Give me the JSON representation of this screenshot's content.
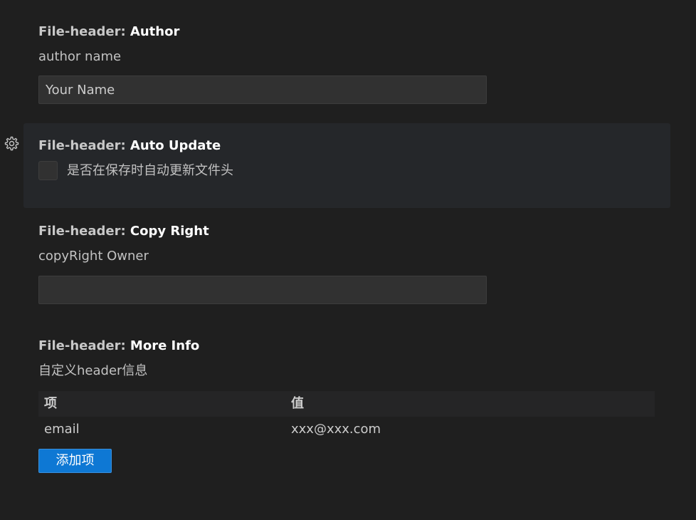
{
  "settings": {
    "author": {
      "category": "File-header: ",
      "name": "Author",
      "description": "author name",
      "value": "Your Name"
    },
    "auto_update": {
      "category": "File-header: ",
      "name": "Auto Update",
      "checkbox_label": "是否在保存时自动更新文件头",
      "checked": false
    },
    "copy_right": {
      "category": "File-header: ",
      "name": "Copy Right",
      "description": "copyRight Owner",
      "value": ""
    },
    "more_info": {
      "category": "File-header: ",
      "name": "More Info",
      "description": "自定义header信息",
      "columns": {
        "key": "项",
        "value": "值"
      },
      "rows": [
        {
          "key": "email",
          "value": "xxx@xxx.com"
        }
      ],
      "add_button_label": "添加项"
    }
  },
  "icons": {
    "gear": "gear-icon"
  },
  "colors": {
    "background": "#1f1f1f",
    "focused_background": "#25272a",
    "input_background": "#313131",
    "accent": "#0e78d4"
  }
}
